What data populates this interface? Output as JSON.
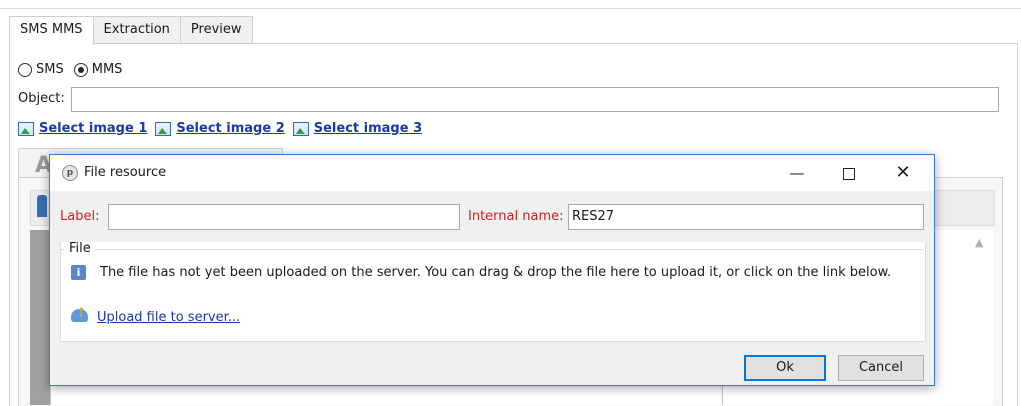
{
  "tabs": [
    "SMS MMS",
    "Extraction",
    "Preview"
  ],
  "message_type": {
    "options": [
      "SMS",
      "MMS"
    ],
    "selected": "MMS"
  },
  "object": {
    "label": "Object:",
    "value": ""
  },
  "image_links": [
    "Select image 1",
    "Select image 2",
    "Select image 3"
  ],
  "background_partial_text": "A",
  "dialog": {
    "title": "File resource",
    "controls": {
      "minimize": "—",
      "close": "✕"
    },
    "label_field": {
      "label": "Label:",
      "value": ""
    },
    "internal_name": {
      "label": "Internal name:",
      "value": "RES27"
    },
    "file_group": {
      "legend": "File",
      "info_text": "The file has not yet been uploaded on the server. You can drag & drop the file here to upload it, or click on the link below.",
      "upload_link": "Upload file to server..."
    },
    "buttons": {
      "ok": "Ok",
      "cancel": "Cancel"
    }
  },
  "colors": {
    "required_label": "#d21f1f",
    "link": "#1a3aa8",
    "dialog_border": "#2f7fd0",
    "default_button_border": "#0078d7"
  }
}
